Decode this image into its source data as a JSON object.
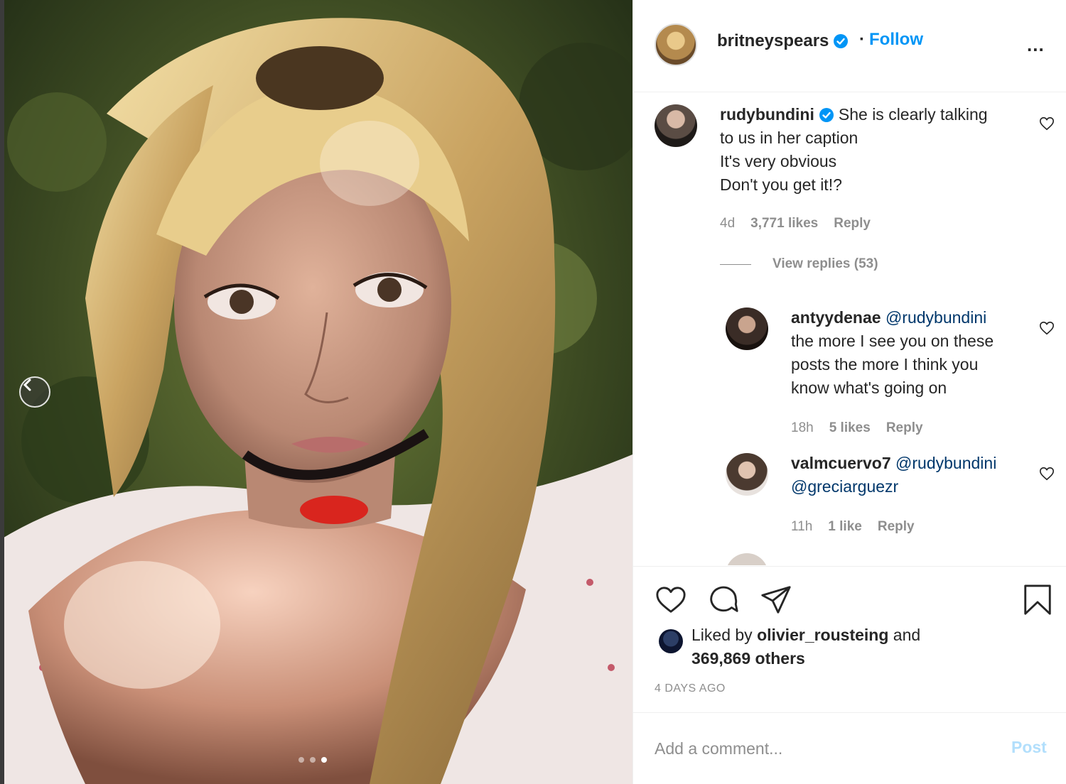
{
  "post": {
    "username": "britneyspears",
    "follow_separator": "·",
    "follow_label": "Follow",
    "more_label": "...",
    "image_dots": 3,
    "active_dot": 2
  },
  "comments": [
    {
      "username": "rudybundini",
      "verified": true,
      "line1": "She is clearly talking",
      "line2": "to us in her caption",
      "line3": "It's very obvious",
      "line4": "Don't you get it!?",
      "time": "4d",
      "likes": "3,771 likes",
      "reply": "Reply"
    }
  ],
  "view_replies_label": "View replies (53)",
  "replies": [
    {
      "username": "antyydenae",
      "mention": "@rudybundini",
      "line1": "the more I see you on these",
      "line2": "posts the more I think you",
      "line3": "know what's going on",
      "time": "18h",
      "likes": "5 likes",
      "reply": "Reply"
    },
    {
      "username": "valmcuervo7",
      "mention": "@rudybundini",
      "mention2": "@greciarguezr",
      "time": "11h",
      "likes": "1 like",
      "reply": "Reply"
    }
  ],
  "likes": {
    "prefix": "Liked by",
    "liker": "olivier_rousteing",
    "and": "and",
    "others": "369,869 others"
  },
  "date": "4 DAYS AGO",
  "add_comment": {
    "placeholder": "Add a comment...",
    "post_label": "Post"
  },
  "colors": {
    "accent": "#0095f6",
    "mention": "#00376b",
    "muted": "#8e8e8e",
    "post_disabled": "#b2dffc"
  },
  "icons": [
    "verified-badge-icon",
    "more-options-icon",
    "heart-icon",
    "comment-icon",
    "share-icon",
    "bookmark-icon",
    "chevron-left-icon"
  ]
}
